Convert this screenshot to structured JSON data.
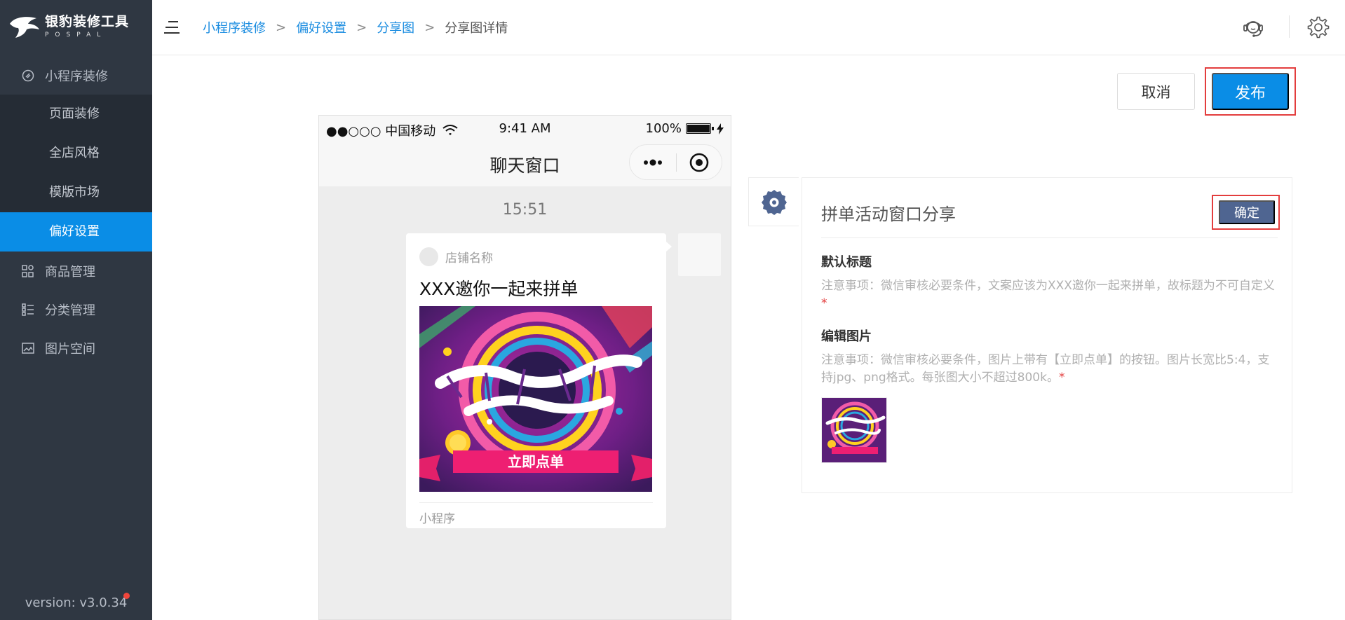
{
  "brand": {
    "title": "银豹装修工具",
    "subtitle": "POSPAL"
  },
  "sidebar": {
    "group_decor": "小程序装修",
    "sub_items": [
      "页面装修",
      "全店风格",
      "模版市场",
      "偏好设置"
    ],
    "active_index": 3,
    "groups": [
      {
        "label": "商品管理",
        "icon": "grid-icon"
      },
      {
        "label": "分类管理",
        "icon": "list-icon"
      },
      {
        "label": "图片空间",
        "icon": "image-icon"
      }
    ],
    "version": "version: v3.0.34"
  },
  "header": {
    "breadcrumb": [
      "小程序装修",
      "偏好设置",
      "分享图"
    ],
    "breadcrumb_current": "分享图详情",
    "separator": ">",
    "icons": [
      "customer-service-icon",
      "gear-icon"
    ]
  },
  "actions": {
    "cancel": "取消",
    "publish": "发布"
  },
  "phone": {
    "carrier": "●●○○○ 中国移动",
    "time": "9:41 AM",
    "battery": "100%",
    "nav_title": "聊天窗口",
    "chat_time": "15:51",
    "card": {
      "store_name": "店铺名称",
      "title": "XXX邀你一起来拼单",
      "image_button": "立即点单",
      "footer": "小程序"
    }
  },
  "panel": {
    "title": "拼单活动窗口分享",
    "confirm": "确定",
    "default_title_label": "默认标题",
    "default_title_note": "注意事项：微信审核必要条件，文案应该为XXX邀你一起来拼单，故标题为不可自定义",
    "edit_image_label": "编辑图片",
    "edit_image_note": "注意事项：微信审核必要条件，图片上带有【立即点单】的按钮。图片长宽比5:4，支持jpg、png格式。每张图大小不超过800k。",
    "required_mark": "*"
  },
  "colors": {
    "accent": "#0a8de6",
    "sidebar": "#2f3742",
    "highlight": "#e33d3d",
    "confirm": "#4f6591"
  }
}
